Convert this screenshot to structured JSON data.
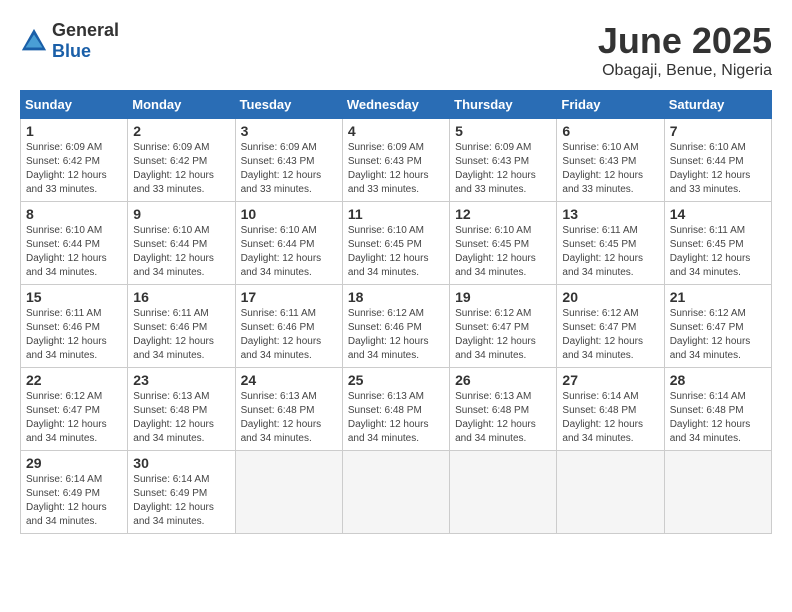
{
  "header": {
    "logo_general": "General",
    "logo_blue": "Blue",
    "month_year": "June 2025",
    "location": "Obagaji, Benue, Nigeria"
  },
  "days_of_week": [
    "Sunday",
    "Monday",
    "Tuesday",
    "Wednesday",
    "Thursday",
    "Friday",
    "Saturday"
  ],
  "weeks": [
    [
      {
        "day": "1",
        "sunrise": "6:09 AM",
        "sunset": "6:42 PM",
        "daylight": "12 hours and 33 minutes."
      },
      {
        "day": "2",
        "sunrise": "6:09 AM",
        "sunset": "6:42 PM",
        "daylight": "12 hours and 33 minutes."
      },
      {
        "day": "3",
        "sunrise": "6:09 AM",
        "sunset": "6:43 PM",
        "daylight": "12 hours and 33 minutes."
      },
      {
        "day": "4",
        "sunrise": "6:09 AM",
        "sunset": "6:43 PM",
        "daylight": "12 hours and 33 minutes."
      },
      {
        "day": "5",
        "sunrise": "6:09 AM",
        "sunset": "6:43 PM",
        "daylight": "12 hours and 33 minutes."
      },
      {
        "day": "6",
        "sunrise": "6:10 AM",
        "sunset": "6:43 PM",
        "daylight": "12 hours and 33 minutes."
      },
      {
        "day": "7",
        "sunrise": "6:10 AM",
        "sunset": "6:44 PM",
        "daylight": "12 hours and 33 minutes."
      }
    ],
    [
      {
        "day": "8",
        "sunrise": "6:10 AM",
        "sunset": "6:44 PM",
        "daylight": "12 hours and 34 minutes."
      },
      {
        "day": "9",
        "sunrise": "6:10 AM",
        "sunset": "6:44 PM",
        "daylight": "12 hours and 34 minutes."
      },
      {
        "day": "10",
        "sunrise": "6:10 AM",
        "sunset": "6:44 PM",
        "daylight": "12 hours and 34 minutes."
      },
      {
        "day": "11",
        "sunrise": "6:10 AM",
        "sunset": "6:45 PM",
        "daylight": "12 hours and 34 minutes."
      },
      {
        "day": "12",
        "sunrise": "6:10 AM",
        "sunset": "6:45 PM",
        "daylight": "12 hours and 34 minutes."
      },
      {
        "day": "13",
        "sunrise": "6:11 AM",
        "sunset": "6:45 PM",
        "daylight": "12 hours and 34 minutes."
      },
      {
        "day": "14",
        "sunrise": "6:11 AM",
        "sunset": "6:45 PM",
        "daylight": "12 hours and 34 minutes."
      }
    ],
    [
      {
        "day": "15",
        "sunrise": "6:11 AM",
        "sunset": "6:46 PM",
        "daylight": "12 hours and 34 minutes."
      },
      {
        "day": "16",
        "sunrise": "6:11 AM",
        "sunset": "6:46 PM",
        "daylight": "12 hours and 34 minutes."
      },
      {
        "day": "17",
        "sunrise": "6:11 AM",
        "sunset": "6:46 PM",
        "daylight": "12 hours and 34 minutes."
      },
      {
        "day": "18",
        "sunrise": "6:12 AM",
        "sunset": "6:46 PM",
        "daylight": "12 hours and 34 minutes."
      },
      {
        "day": "19",
        "sunrise": "6:12 AM",
        "sunset": "6:47 PM",
        "daylight": "12 hours and 34 minutes."
      },
      {
        "day": "20",
        "sunrise": "6:12 AM",
        "sunset": "6:47 PM",
        "daylight": "12 hours and 34 minutes."
      },
      {
        "day": "21",
        "sunrise": "6:12 AM",
        "sunset": "6:47 PM",
        "daylight": "12 hours and 34 minutes."
      }
    ],
    [
      {
        "day": "22",
        "sunrise": "6:12 AM",
        "sunset": "6:47 PM",
        "daylight": "12 hours and 34 minutes."
      },
      {
        "day": "23",
        "sunrise": "6:13 AM",
        "sunset": "6:48 PM",
        "daylight": "12 hours and 34 minutes."
      },
      {
        "day": "24",
        "sunrise": "6:13 AM",
        "sunset": "6:48 PM",
        "daylight": "12 hours and 34 minutes."
      },
      {
        "day": "25",
        "sunrise": "6:13 AM",
        "sunset": "6:48 PM",
        "daylight": "12 hours and 34 minutes."
      },
      {
        "day": "26",
        "sunrise": "6:13 AM",
        "sunset": "6:48 PM",
        "daylight": "12 hours and 34 minutes."
      },
      {
        "day": "27",
        "sunrise": "6:14 AM",
        "sunset": "6:48 PM",
        "daylight": "12 hours and 34 minutes."
      },
      {
        "day": "28",
        "sunrise": "6:14 AM",
        "sunset": "6:48 PM",
        "daylight": "12 hours and 34 minutes."
      }
    ],
    [
      {
        "day": "29",
        "sunrise": "6:14 AM",
        "sunset": "6:49 PM",
        "daylight": "12 hours and 34 minutes."
      },
      {
        "day": "30",
        "sunrise": "6:14 AM",
        "sunset": "6:49 PM",
        "daylight": "12 hours and 34 minutes."
      },
      {
        "day": "",
        "sunrise": "",
        "sunset": "",
        "daylight": ""
      },
      {
        "day": "",
        "sunrise": "",
        "sunset": "",
        "daylight": ""
      },
      {
        "day": "",
        "sunrise": "",
        "sunset": "",
        "daylight": ""
      },
      {
        "day": "",
        "sunrise": "",
        "sunset": "",
        "daylight": ""
      },
      {
        "day": "",
        "sunrise": "",
        "sunset": "",
        "daylight": ""
      }
    ]
  ]
}
